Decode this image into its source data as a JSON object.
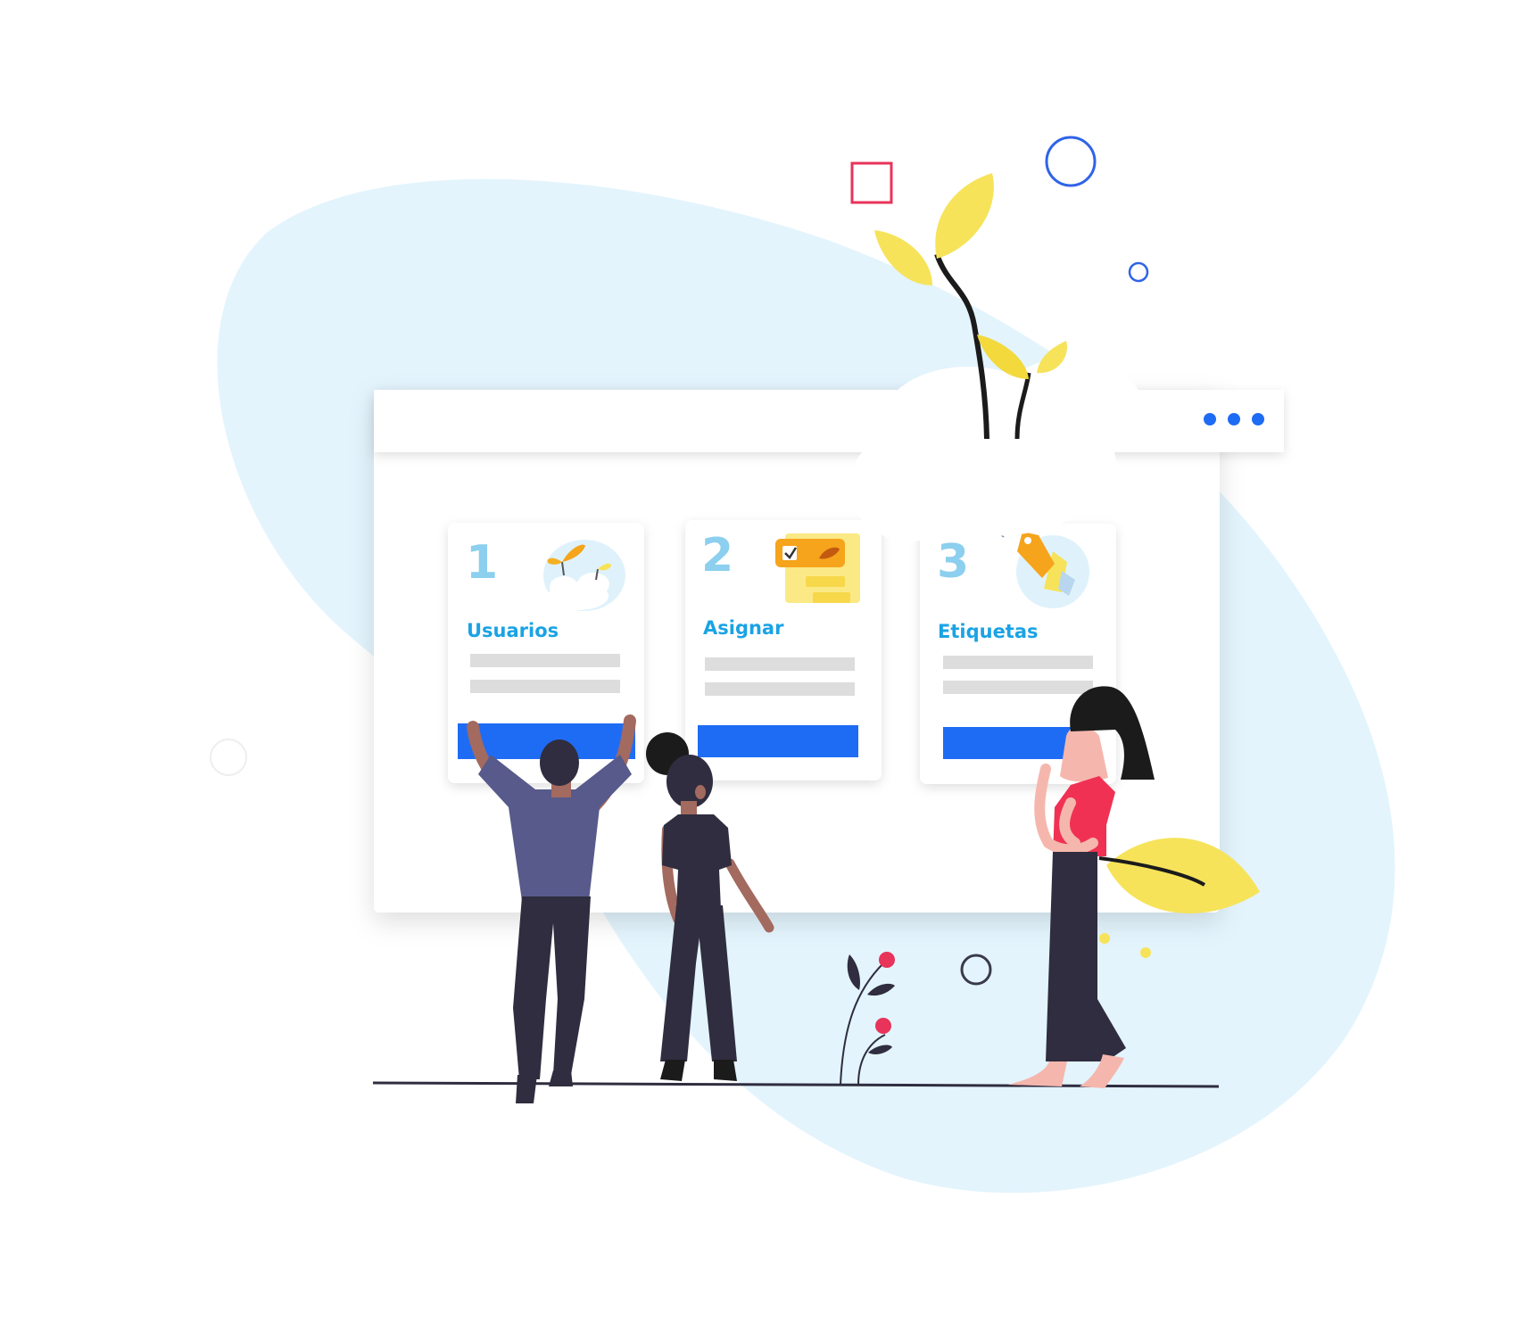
{
  "colors": {
    "blob": "#e3f4fd",
    "card": "#ffffff",
    "placeholder": "#dddddd",
    "button": "#1f6cf4",
    "number": "#8ccfee",
    "title": "#1aa3e4",
    "accent_red": "#e8335a",
    "accent_blue": "#2f63e8",
    "leaf": "#f6e35a",
    "dark": "#2f2d3f"
  },
  "cards": [
    {
      "number": "1",
      "title": "Usuarios",
      "icon": "sprout-cloud-icon"
    },
    {
      "number": "2",
      "title": "Asignar",
      "icon": "checklist-note-icon"
    },
    {
      "number": "3",
      "title": "Etiquetas",
      "icon": "price-tag-icon"
    }
  ],
  "window": {
    "menu_icon": "more-dots-icon"
  }
}
